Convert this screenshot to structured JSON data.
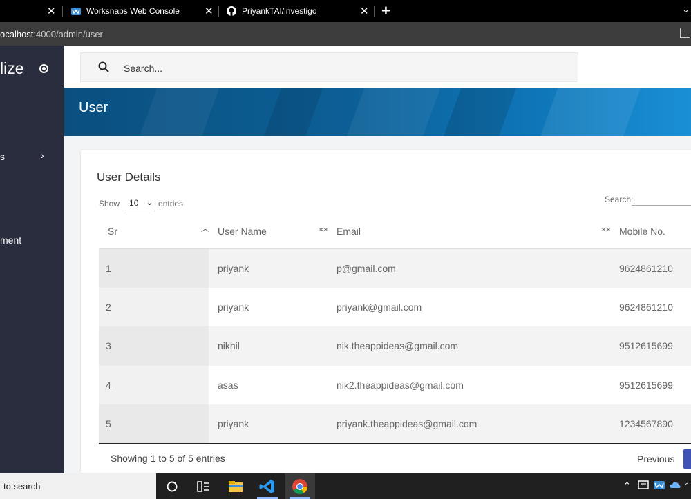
{
  "browser": {
    "tabs": [
      {
        "label": "Worksnaps Web Console",
        "icon": "worksnaps-icon"
      },
      {
        "label": "PriyankTAI/investigo",
        "icon": "github-icon"
      }
    ],
    "url_host": "ocalhost",
    "url_path": ":4000/admin/user"
  },
  "sidebar": {
    "brand": "lize",
    "items": [
      {
        "label": "s",
        "has_chevron": true
      },
      {
        "label": "ment",
        "has_chevron": false
      }
    ]
  },
  "topbar": {
    "search_placeholder": "Search..."
  },
  "banner": {
    "title": "User"
  },
  "card": {
    "title": "User Details",
    "show_label": "Show",
    "entries_label": "entries",
    "page_size": "10",
    "search_label": "Search:",
    "columns": [
      "Sr",
      "User Name",
      "Email",
      "Mobile No."
    ],
    "rows": [
      {
        "sr": "1",
        "name": "priyank",
        "email": "p@gmail.com",
        "mobile": "9624861210"
      },
      {
        "sr": "2",
        "name": "priyank",
        "email": "priyank@gmail.com",
        "mobile": "9624861210"
      },
      {
        "sr": "3",
        "name": "nikhil",
        "email": "nik.theappideas@gmail.com",
        "mobile": "9512615699"
      },
      {
        "sr": "4",
        "name": "asas",
        "email": "nik2.theappideas@gmail.com",
        "mobile": "9512615699"
      },
      {
        "sr": "5",
        "name": "priyank",
        "email": "priyank.theappideas@gmail.com",
        "mobile": "1234567890"
      }
    ],
    "info": "Showing 1 to 5 of 5 entries",
    "previous_label": "Previous"
  },
  "taskbar": {
    "search_text": "to search"
  },
  "colors": {
    "sidebar_bg": "#2a2d3e",
    "banner_blue": "#0c5f96",
    "accent": "#3f51b5"
  }
}
